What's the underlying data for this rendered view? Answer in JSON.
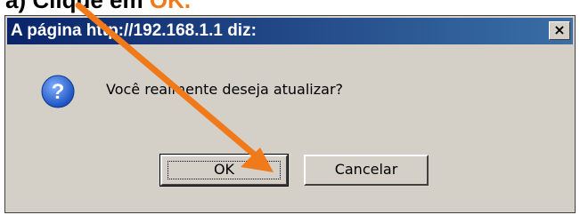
{
  "caption": {
    "prefix": "a) Clique em ",
    "highlight": "OK."
  },
  "dialog": {
    "title": "A página http://192.168.1.1 diz:",
    "close_label": "×",
    "message": "Você realmente deseja atualizar?",
    "icon": "question-icon",
    "ok_label": "OK",
    "cancel_label": "Cancelar"
  },
  "colors": {
    "titlebar": "#0a246a",
    "face": "#d4d0c8",
    "arrow": "#f07a1a",
    "icon": "#2f6fd6"
  }
}
